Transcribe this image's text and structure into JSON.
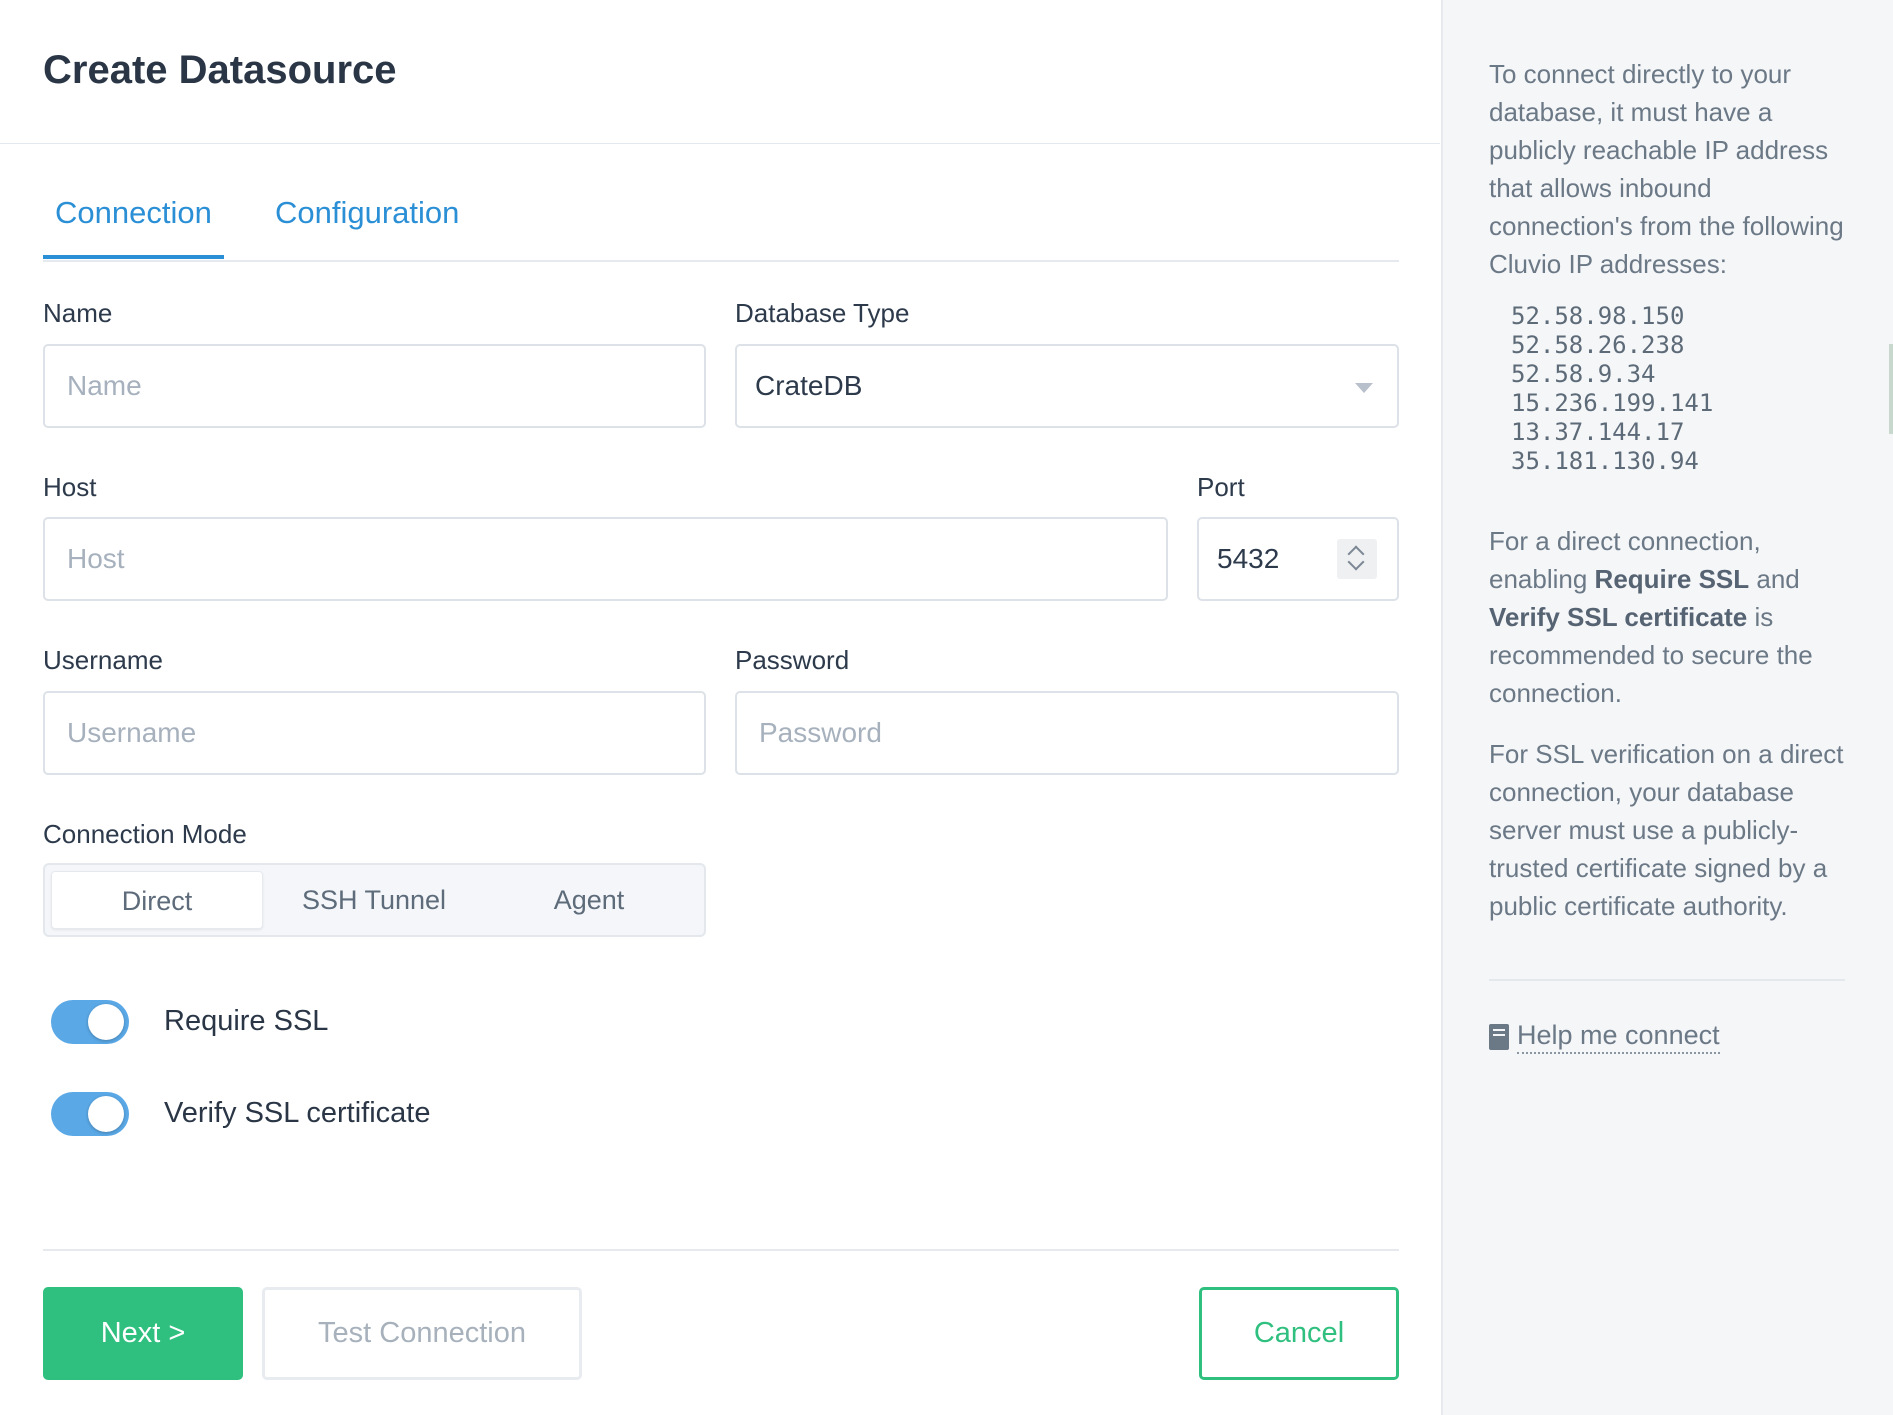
{
  "title": "Create Datasource",
  "tabs": [
    {
      "label": "Connection",
      "active": true
    },
    {
      "label": "Configuration",
      "active": false
    }
  ],
  "form": {
    "name": {
      "label": "Name",
      "placeholder": "Name",
      "value": ""
    },
    "database_type": {
      "label": "Database Type",
      "value": "CrateDB"
    },
    "host": {
      "label": "Host",
      "placeholder": "Host",
      "value": ""
    },
    "port": {
      "label": "Port",
      "value": "5432"
    },
    "username": {
      "label": "Username",
      "placeholder": "Username",
      "value": ""
    },
    "password": {
      "label": "Password",
      "placeholder": "Password",
      "value": ""
    },
    "connection_mode": {
      "label": "Connection Mode",
      "options": [
        "Direct",
        "SSH Tunnel",
        "Agent"
      ],
      "selected": "Direct"
    },
    "require_ssl": {
      "label": "Require SSL",
      "enabled": true
    },
    "verify_ssl": {
      "label": "Verify SSL certificate",
      "enabled": true
    }
  },
  "buttons": {
    "next": "Next >",
    "test": "Test Connection",
    "cancel": "Cancel"
  },
  "sidebar": {
    "intro": "To connect directly to your database, it must have a publicly reachable IP address that allows inbound connection's from the following Cluvio IP addresses:",
    "ips": [
      "52.58.98.150",
      "52.58.26.238",
      "52.58.9.34",
      "15.236.199.141",
      "13.37.144.17",
      "35.181.130.94"
    ],
    "ssl_note": {
      "prefix": "For a direct connection, enabling ",
      "bold1": "Require SSL",
      "middle": " and ",
      "bold2": "Verify SSL certificate",
      "suffix": " is recommended to secure the connection."
    },
    "verification_note": "For SSL verification on a direct connection, your database server must use a publicly-trusted certificate signed by a public certificate authority.",
    "help_link": "Help me connect"
  },
  "colors": {
    "accent": "#2b8fd6",
    "primary_button": "#2fbf7f",
    "toggle": "#5aa8e6"
  }
}
